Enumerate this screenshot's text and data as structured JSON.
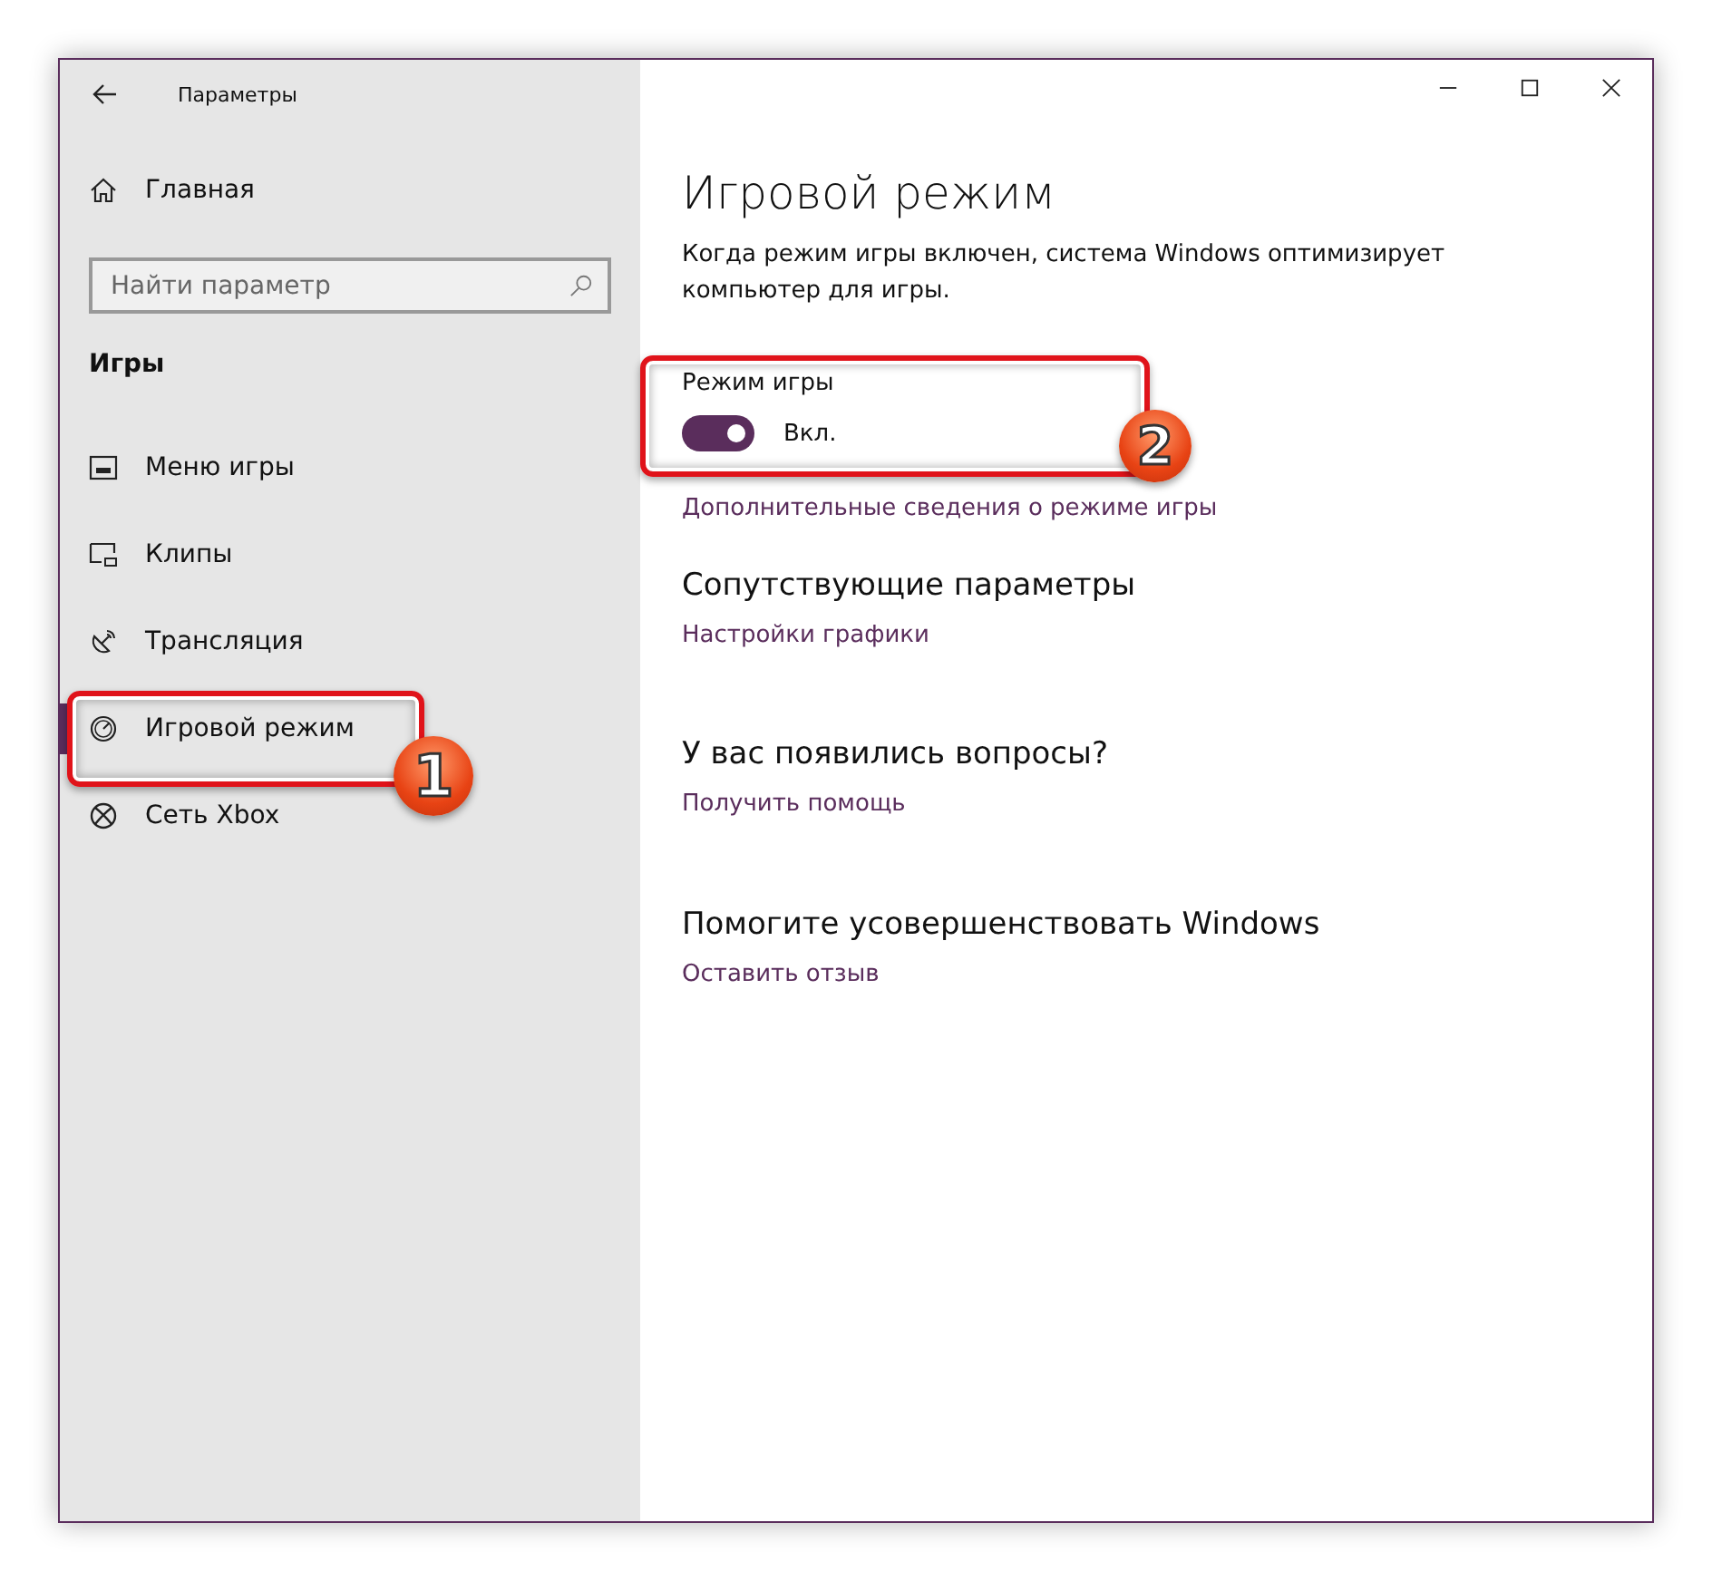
{
  "window": {
    "title": "Параметры"
  },
  "sidebar": {
    "home": "Главная",
    "search": {
      "placeholder": "Найти параметр"
    },
    "section": "Игры",
    "items": [
      {
        "label": "Меню игры",
        "kind": "menu",
        "selected": false
      },
      {
        "label": "Клипы",
        "kind": "clips",
        "selected": false
      },
      {
        "label": "Трансляция",
        "kind": "broadcast",
        "selected": false
      },
      {
        "label": "Игровой режим",
        "kind": "gauge",
        "selected": true
      },
      {
        "label": "Сеть Xbox",
        "kind": "xbox",
        "selected": false
      }
    ]
  },
  "content": {
    "title": "Игровой режим",
    "description": "Когда режим игры включен, система Windows оптимизирует компьютер для игры.",
    "toggle": {
      "label": "Режим игры",
      "on": true,
      "state_text": "Вкл."
    },
    "link": "Дополнительные сведения о режиме игры",
    "sections": [
      {
        "heading": "Сопутствующие параметры",
        "link": "Настройки графики"
      },
      {
        "heading": "У вас появились вопросы?",
        "link": "Получить помощь"
      },
      {
        "heading": "Помогите усовершенствовать Windows",
        "link": "Оставить отзыв"
      }
    ]
  },
  "annotations": [
    {
      "number": "1"
    },
    {
      "number": "2"
    }
  ]
}
